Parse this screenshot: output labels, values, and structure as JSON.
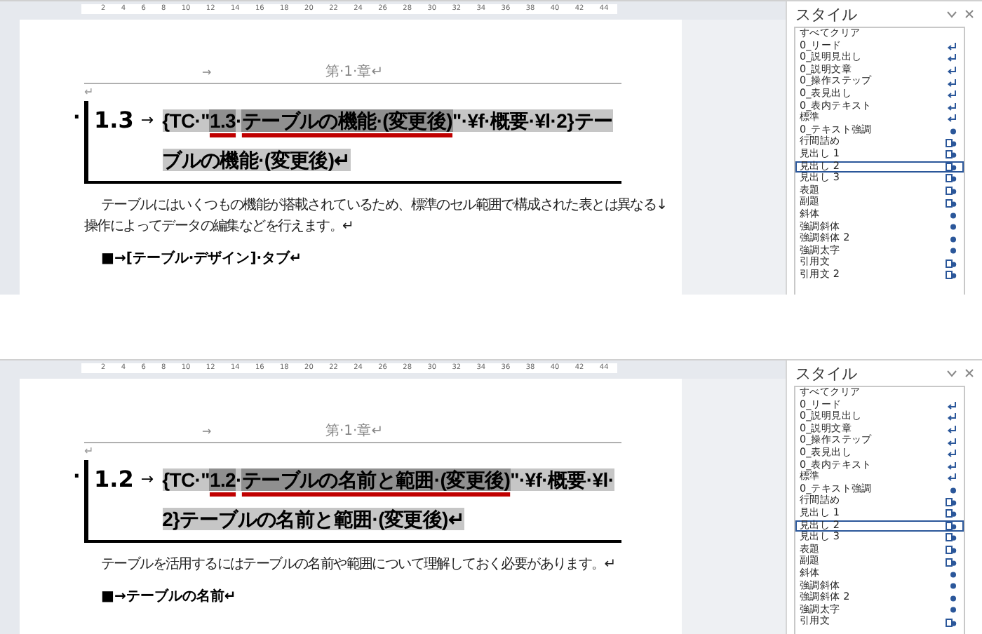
{
  "panels": [
    {
      "ruler": {
        "numbers": [
          "2",
          "4",
          "6",
          "8",
          "10",
          "12",
          "14",
          "16",
          "18",
          "20",
          "22",
          "24",
          "26",
          "28",
          "30",
          "32",
          "34",
          "36",
          "38",
          "40",
          "42",
          "44"
        ]
      },
      "header": {
        "tab_mark": "→",
        "text": "第·1·章↵"
      },
      "empty_paragraph_mark": "↵",
      "heading": {
        "bullet": "·",
        "number": "1.3",
        "tab_mark": "→",
        "segments": [
          {
            "text": "{TC·\"",
            "kind": "field"
          },
          {
            "text": "1.3",
            "kind": "selected"
          },
          {
            "text": "·",
            "kind": "field"
          },
          {
            "text": "テーブルの機能·(変更後)",
            "kind": "selected"
          },
          {
            "text": "\"·¥f·概要·¥l·2}",
            "kind": "field"
          },
          {
            "text": "テーブルの機能·(変更後)↵",
            "kind": "result"
          }
        ]
      },
      "body": {
        "lines": [
          "テーブルにはいくつもの機能が搭載されているため、標準のセル範囲で構成された表とは異なる↓",
          "操作によってデータの編集などを行えます。↵"
        ]
      },
      "subheading": "■→[テーブル·デザイン]·タブ↵",
      "styles_pane": {
        "title": "スタイル",
        "items": [
          {
            "name": "すべてクリア",
            "kind": "none",
            "selected": false
          },
          {
            "name": "0_リード",
            "kind": "paragraph",
            "selected": false
          },
          {
            "name": "0_説明見出し",
            "kind": "paragraph",
            "selected": false
          },
          {
            "name": "0_説明文章",
            "kind": "paragraph",
            "selected": false
          },
          {
            "name": "0_操作ステップ",
            "kind": "paragraph",
            "selected": false
          },
          {
            "name": "0_表見出し",
            "kind": "paragraph",
            "selected": false
          },
          {
            "name": "0_表内テキスト",
            "kind": "paragraph",
            "selected": false
          },
          {
            "name": "標準",
            "kind": "paragraph",
            "selected": false
          },
          {
            "name": "0_テキスト強調",
            "kind": "character",
            "selected": false
          },
          {
            "name": "行間詰め",
            "kind": "linked",
            "selected": false
          },
          {
            "name": "見出し 1",
            "kind": "linked",
            "selected": false
          },
          {
            "name": "見出し 2",
            "kind": "linked",
            "selected": true
          },
          {
            "name": "見出し 3",
            "kind": "linked",
            "selected": false
          },
          {
            "name": "表題",
            "kind": "linked",
            "selected": false
          },
          {
            "name": "副題",
            "kind": "linked",
            "selected": false
          },
          {
            "name": "斜体",
            "kind": "character",
            "selected": false
          },
          {
            "name": "強調斜体",
            "kind": "character",
            "selected": false
          },
          {
            "name": "強調斜体 2",
            "kind": "character",
            "selected": false
          },
          {
            "name": "強調太字",
            "kind": "character",
            "selected": false
          },
          {
            "name": "引用文",
            "kind": "linked",
            "selected": false
          },
          {
            "name": "引用文 2",
            "kind": "linked",
            "selected": false
          }
        ]
      }
    },
    {
      "ruler": {
        "numbers": [
          "2",
          "4",
          "6",
          "8",
          "10",
          "12",
          "14",
          "16",
          "18",
          "20",
          "22",
          "24",
          "26",
          "28",
          "30",
          "32",
          "34",
          "36",
          "38",
          "40",
          "42",
          "44"
        ]
      },
      "header": {
        "tab_mark": "→",
        "text": "第·1·章↵"
      },
      "empty_paragraph_mark": "↵",
      "heading": {
        "bullet": "·",
        "number": "1.2",
        "tab_mark": "→",
        "segments": [
          {
            "text": "{TC·\"",
            "kind": "field"
          },
          {
            "text": "1.2",
            "kind": "selected"
          },
          {
            "text": "·",
            "kind": "field"
          },
          {
            "text": "テーブルの名前と範囲·(変更後)",
            "kind": "selected"
          },
          {
            "text": "\"·¥f·概要·¥l·2}",
            "kind": "field"
          },
          {
            "text": "テーブルの名前と範囲·(変更後)↵",
            "kind": "result"
          }
        ]
      },
      "body": {
        "lines": [
          "テーブルを活用するにはテーブルの名前や範囲について理解しておく必要があります。↵"
        ]
      },
      "subheading": "■→テーブルの名前↵",
      "styles_pane": {
        "title": "スタイル",
        "items": [
          {
            "name": "すべてクリア",
            "kind": "none",
            "selected": false
          },
          {
            "name": "0_リード",
            "kind": "paragraph",
            "selected": false
          },
          {
            "name": "0_説明見出し",
            "kind": "paragraph",
            "selected": false
          },
          {
            "name": "0_説明文章",
            "kind": "paragraph",
            "selected": false
          },
          {
            "name": "0_操作ステップ",
            "kind": "paragraph",
            "selected": false
          },
          {
            "name": "0_表見出し",
            "kind": "paragraph",
            "selected": false
          },
          {
            "name": "0_表内テキスト",
            "kind": "paragraph",
            "selected": false
          },
          {
            "name": "標準",
            "kind": "paragraph",
            "selected": false
          },
          {
            "name": "0_テキスト強調",
            "kind": "character",
            "selected": false
          },
          {
            "name": "行間詰め",
            "kind": "linked",
            "selected": false
          },
          {
            "name": "見出し 1",
            "kind": "linked",
            "selected": false
          },
          {
            "name": "見出し 2",
            "kind": "linked",
            "selected": true
          },
          {
            "name": "見出し 3",
            "kind": "linked",
            "selected": false
          },
          {
            "name": "表題",
            "kind": "linked",
            "selected": false
          },
          {
            "name": "副題",
            "kind": "linked",
            "selected": false
          },
          {
            "name": "斜体",
            "kind": "character",
            "selected": false
          },
          {
            "name": "強調斜体",
            "kind": "character",
            "selected": false
          },
          {
            "name": "強調斜体 2",
            "kind": "character",
            "selected": false
          },
          {
            "name": "強調太字",
            "kind": "character",
            "selected": false
          },
          {
            "name": "引用文",
            "kind": "linked",
            "selected": false
          }
        ]
      }
    }
  ]
}
